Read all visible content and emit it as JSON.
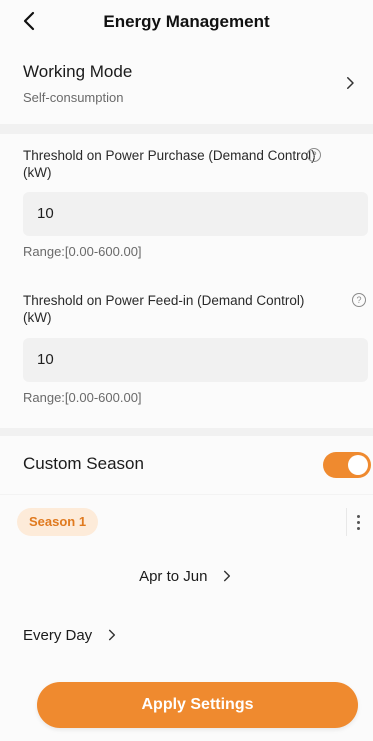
{
  "header": {
    "title": "Energy Management",
    "back_icon": "chevron-left-icon"
  },
  "working_mode": {
    "label": "Working Mode",
    "value": "Self-consumption",
    "chevron_icon": "chevron-right-icon"
  },
  "threshold_purchase": {
    "label": "Threshold on Power Purchase (Demand Control)(kW)",
    "value": "10",
    "range": "Range:[0.00-600.00]",
    "help_icon": "help-circle-icon"
  },
  "threshold_feedin": {
    "label": "Threshold on Power Feed-in (Demand Control)(kW)",
    "value": "10",
    "range": "Range:[0.00-600.00]",
    "help_icon": "help-circle-icon"
  },
  "custom_season": {
    "label": "Custom Season",
    "enabled": true
  },
  "season": {
    "chip_label": "Season 1",
    "period": "Apr to Jun",
    "more_icon": "more-vertical-icon"
  },
  "schedule": {
    "label": "Every Day"
  },
  "apply_button": {
    "label": "Apply Settings"
  },
  "colors": {
    "accent": "#ef8a2f",
    "chip_bg": "#fdebd9",
    "input_bg": "#f1f1f1"
  }
}
